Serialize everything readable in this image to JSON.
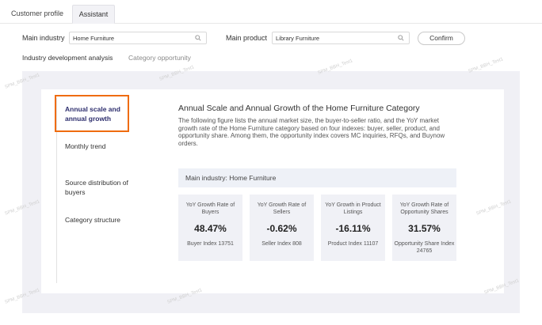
{
  "tabs": [
    {
      "label": "Customer profile"
    },
    {
      "label": "Assistant"
    }
  ],
  "filters": {
    "industry_label": "Main industry",
    "industry_value": "Home Furniture",
    "product_label": "Main product",
    "product_value": "Library Furniture",
    "confirm_label": "Confirm"
  },
  "subtabs": [
    {
      "label": "Industry development analysis"
    },
    {
      "label": "Category opportunity"
    }
  ],
  "sidebar": {
    "items": [
      {
        "label": "Annual scale and annual growth"
      },
      {
        "label": "Monthly trend"
      },
      {
        "label": "Source distribution of buyers"
      },
      {
        "label": "Category structure"
      }
    ]
  },
  "main": {
    "title": "Annual Scale and Annual Growth of the Home Furniture Category",
    "description": "The following figure lists the annual market size, the buyer-to-seller ratio, and the YoY market growth rate of the Home Furniture category based on four indexes: buyer, seller, product, and opportunity share. Among them, the opportunity index covers MC inquiries, RFQs, and Buynow orders.",
    "industry_bar": "Main industry: Home Furniture",
    "stats": [
      {
        "label": "YoY Growth Rate of Buyers",
        "value": "48.47%",
        "sub": "Buyer Index 13751"
      },
      {
        "label": "YoY Growth Rate of Sellers",
        "value": "-0.62%",
        "sub": "Seller Index 808"
      },
      {
        "label": "YoY Growth in Product Listings",
        "value": "-16.11%",
        "sub": "Product Index 11107"
      },
      {
        "label": "YoY Growth Rate of Opportunity Shares",
        "value": "31.57%",
        "sub": "Opportunity Share Index 24765"
      }
    ]
  },
  "watermark": "SPM_BBH_Test1",
  "colors": {
    "highlight_border": "#ef6c0f",
    "active_text": "#2e2f6e",
    "panel_bg": "#f0f0f5"
  }
}
